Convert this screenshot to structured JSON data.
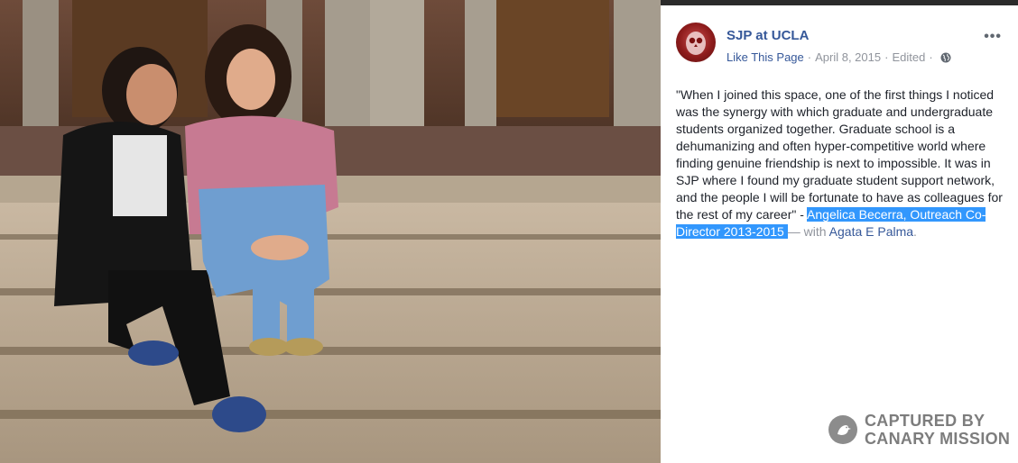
{
  "post": {
    "page_name": "SJP at UCLA",
    "like_link": "Like This Page",
    "date": "April 8, 2015",
    "edited": "Edited",
    "more_label": "•••",
    "quote": "\"When I joined this space, one of the first things I noticed was the synergy with which graduate and undergraduate students organized together. Graduate school is a dehumanizing and often hyper-competitive world where finding genuine friendship is next to impossible. It was in SJP where I found my graduate student support network, and the people I will be fortunate to have as colleagues for the rest of my career\" - ",
    "attribution": "Angelica Becerra, Outreach Co-Director 2013-2015 ",
    "with_prefix": "— with ",
    "tagged_person": "Agata E Palma",
    "with_suffix": "."
  },
  "watermark": {
    "line1": "CAPTURED BY",
    "line2": "CANARY MISSION"
  },
  "icons": {
    "privacy": "globe-icon",
    "avatar": "owl-logo-icon",
    "watermark": "canary-bird-icon"
  },
  "colors": {
    "link": "#365899",
    "meta": "#90949c",
    "selection": "#3297fd"
  }
}
